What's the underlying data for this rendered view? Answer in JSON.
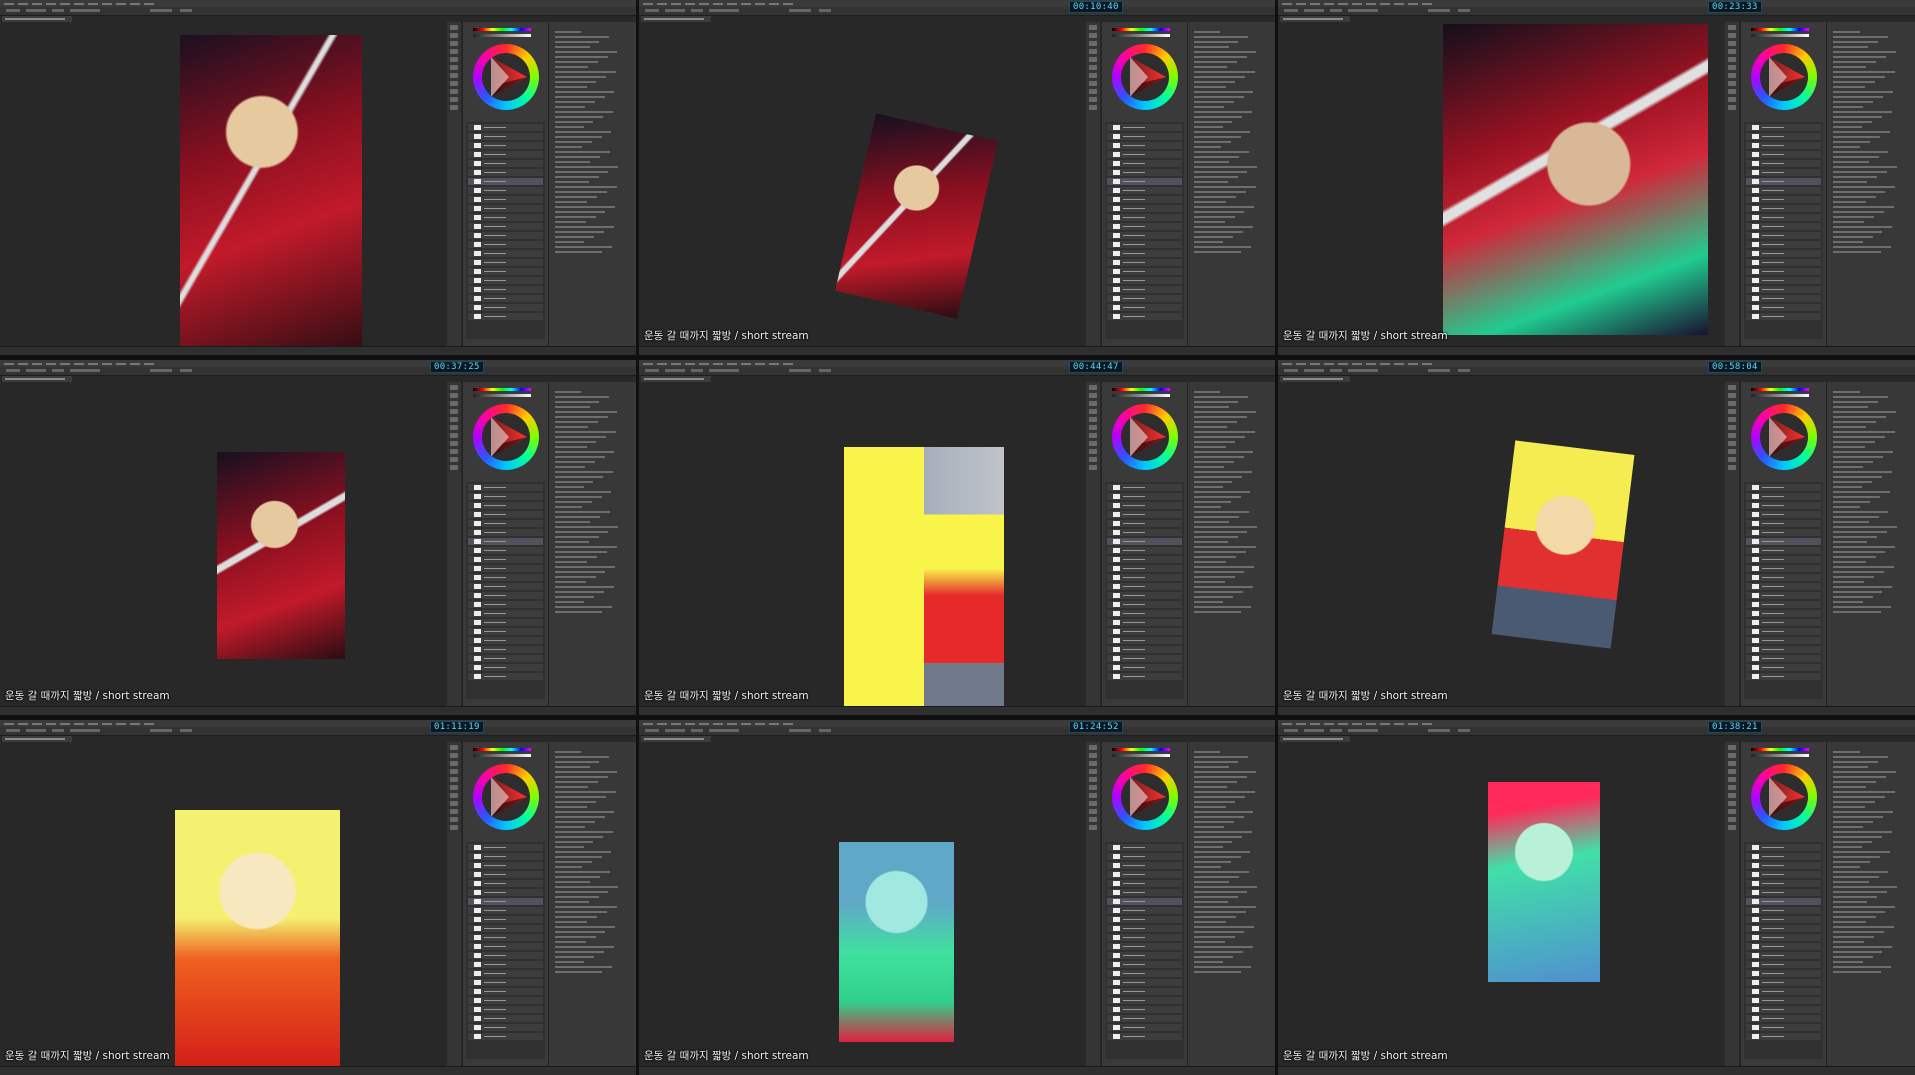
{
  "caption": "운동 갈 때까지 짧방 / short stream",
  "frames": [
    {
      "id": 1,
      "timestamp": "",
      "show_caption": false
    },
    {
      "id": 2,
      "timestamp": "00:10:40",
      "show_caption": true
    },
    {
      "id": 3,
      "timestamp": "00:23:33",
      "show_caption": true
    },
    {
      "id": 4,
      "timestamp": "00:37:25",
      "show_caption": true
    },
    {
      "id": 5,
      "timestamp": "00:44:47",
      "show_caption": true
    },
    {
      "id": 6,
      "timestamp": "00:58:04",
      "show_caption": true
    },
    {
      "id": 7,
      "timestamp": "01:11:19",
      "show_caption": true
    },
    {
      "id": 8,
      "timestamp": "01:24:52",
      "show_caption": true
    },
    {
      "id": 9,
      "timestamp": "01:38:21",
      "show_caption": true
    }
  ],
  "colors": {
    "app_bg": "#282828",
    "panel_bg": "#383838",
    "timestamp_text": "#4fe0ff",
    "caption_text": "#f2f2f2"
  },
  "icons": [
    "color-wheel-icon",
    "tool-icon",
    "layer-thumbnail-icon"
  ]
}
